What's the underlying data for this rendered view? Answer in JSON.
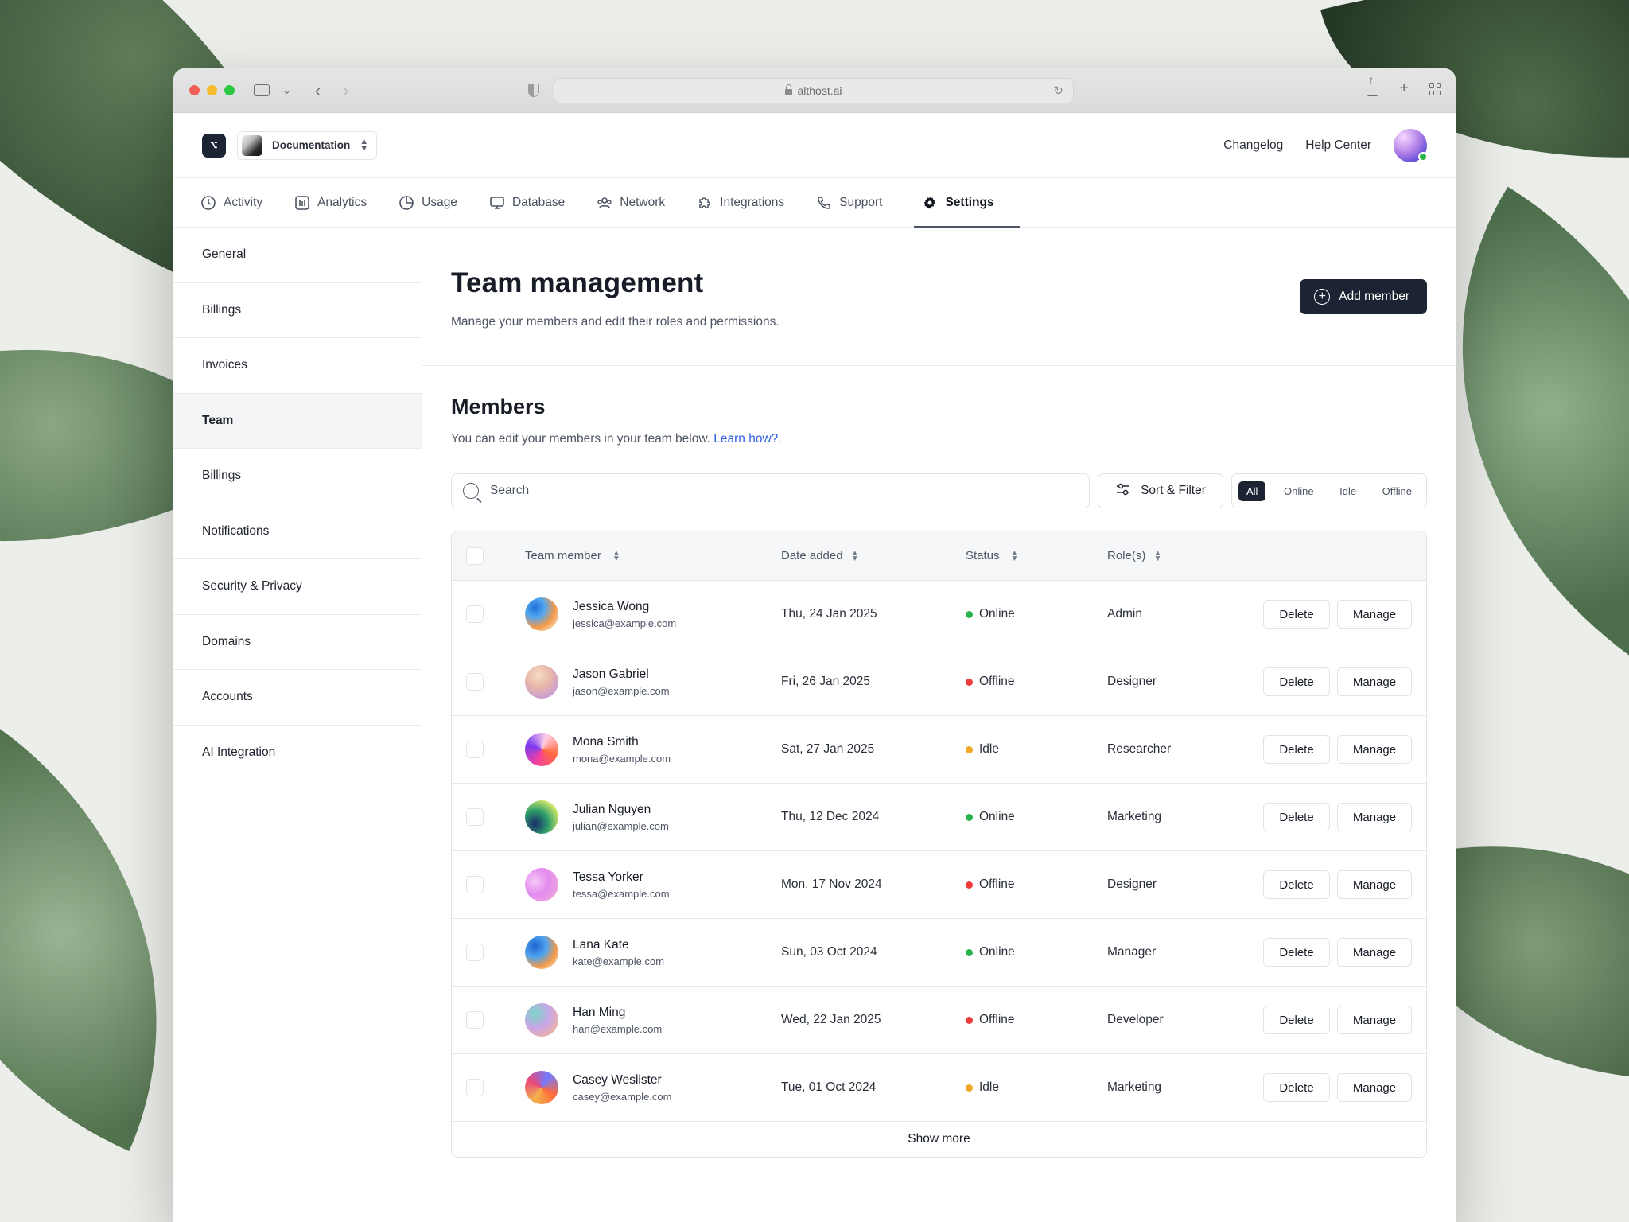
{
  "browser": {
    "url": "althost.ai"
  },
  "header": {
    "workspace_label": "Documentation",
    "links": [
      "Changelog",
      "Help Center"
    ]
  },
  "nav": {
    "items": [
      {
        "label": "Activity",
        "icon": "clock-icon"
      },
      {
        "label": "Analytics",
        "icon": "bar-chart-icon"
      },
      {
        "label": "Usage",
        "icon": "pie-chart-icon"
      },
      {
        "label": "Database",
        "icon": "monitor-icon"
      },
      {
        "label": "Network",
        "icon": "users-network-icon"
      },
      {
        "label": "Integrations",
        "icon": "puzzle-icon"
      },
      {
        "label": "Support",
        "icon": "phone-icon"
      },
      {
        "label": "Settings",
        "icon": "gear-icon",
        "active": true
      }
    ]
  },
  "sidebar": {
    "items": [
      {
        "label": "General"
      },
      {
        "label": "Billings"
      },
      {
        "label": "Invoices"
      },
      {
        "label": "Team",
        "active": true
      },
      {
        "label": "Billings"
      },
      {
        "label": "Notifications"
      },
      {
        "label": "Security & Privacy"
      },
      {
        "label": "Domains"
      },
      {
        "label": "Accounts"
      },
      {
        "label": "AI Integration"
      }
    ]
  },
  "page": {
    "title": "Team management",
    "subtitle": "Manage your members and edit their roles and permissions.",
    "add_button": "Add member"
  },
  "members": {
    "title": "Members",
    "subtitle": "You can edit your members in your team below.",
    "learn_link": "Learn how?",
    "subtitle_end": ".",
    "search_placeholder": "Search",
    "sort_filter_label": "Sort & Filter",
    "segments": [
      "All",
      "Online",
      "Idle",
      "Offline"
    ],
    "selected_segment": "All",
    "columns": [
      "Team member",
      "Date added",
      "Status",
      "Role(s)"
    ],
    "rows": [
      {
        "name": "Jessica Wong",
        "email": "jessica@example.com",
        "date": "Thu, 24 Jan 2025",
        "status": "Online",
        "role": "Admin"
      },
      {
        "name": "Jason Gabriel",
        "email": "jason@example.com",
        "date": "Fri, 26 Jan 2025",
        "status": "Offline",
        "role": "Designer"
      },
      {
        "name": "Mona Smith",
        "email": "mona@example.com",
        "date": "Sat, 27 Jan 2025",
        "status": "Idle",
        "role": "Researcher"
      },
      {
        "name": "Julian Nguyen",
        "email": "julian@example.com",
        "date": "Thu, 12 Dec 2024",
        "status": "Online",
        "role": "Marketing"
      },
      {
        "name": "Tessa Yorker",
        "email": "tessa@example.com",
        "date": "Mon, 17 Nov 2024",
        "status": "Offline",
        "role": "Designer"
      },
      {
        "name": "Lana Kate",
        "email": "kate@example.com",
        "date": "Sun, 03 Oct 2024",
        "status": "Online",
        "role": "Manager"
      },
      {
        "name": "Han Ming",
        "email": "han@example.com",
        "date": "Wed, 22 Jan 2025",
        "status": "Offline",
        "role": "Developer"
      },
      {
        "name": "Casey Weslister",
        "email": "casey@example.com",
        "date": "Tue, 01 Oct 2024",
        "status": "Idle",
        "role": "Marketing"
      }
    ],
    "delete_label": "Delete",
    "manage_label": "Manage",
    "show_more": "Show more"
  },
  "colors": {
    "accent_dark": "#1c2333",
    "link": "#2f5fe0",
    "status_online": "#29b34a",
    "status_offline": "#ef3b3b",
    "status_idle": "#f4a723"
  }
}
